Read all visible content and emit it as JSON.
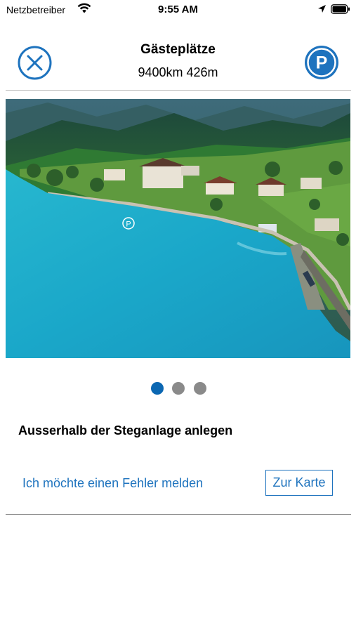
{
  "status_bar": {
    "carrier": "Netzbetreiber",
    "time": "9:55 AM"
  },
  "header": {
    "title": "Gästeplätze",
    "distance": "9400km 426m",
    "close_icon": "close-circle-icon",
    "parking_icon": "parking-icon",
    "parking_letter": "P",
    "accent_color": "#1e73be"
  },
  "photo": {
    "marker_letter": "P",
    "pager": {
      "pages": 3,
      "current": 1,
      "active_color": "#0b67b2",
      "inactive_color": "#8a8a8a"
    }
  },
  "main": {
    "description": "Ausserhalb der Steganlage anlegen",
    "report_link": "Ich möchte einen Fehler melden",
    "map_button": "Zur Karte"
  }
}
